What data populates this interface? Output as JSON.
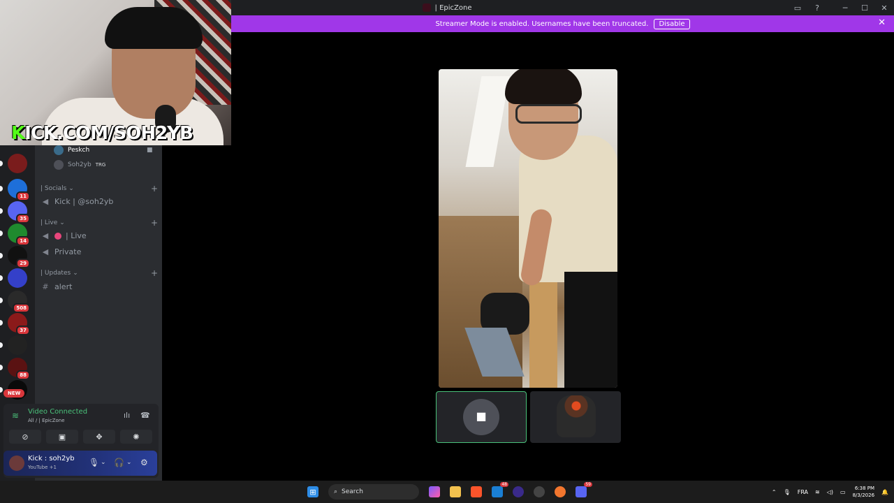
{
  "window": {
    "title": "| EpicZone"
  },
  "banner": {
    "text": "Streamer Mode is enabled. Usernames have been truncated.",
    "button": "Disable"
  },
  "webcam": {
    "overlay_prefix": "K",
    "overlay_text": "ICK.COM/SOH2YB"
  },
  "guilds": [
    {
      "badge": "",
      "color": "#7a1c1c"
    },
    {
      "badge": "11",
      "color": "#1e6fd9"
    },
    {
      "badge": "35",
      "color": "#5865f2"
    },
    {
      "badge": "14",
      "color": "#1f8a2e"
    },
    {
      "badge": "29",
      "color": "#111111"
    },
    {
      "badge": "",
      "color": "#3440c9"
    },
    {
      "badge": "508",
      "color": "#2a2a2a"
    },
    {
      "badge": "37",
      "color": "#8b1a1a"
    },
    {
      "badge": "",
      "color": "#222222"
    },
    {
      "badge": "88",
      "color": "#5a1212"
    },
    {
      "badge": "",
      "color": "#0a0a0a"
    }
  ],
  "new_badge": "NEW",
  "voice_users": [
    {
      "name": "Peskch",
      "tag": ""
    },
    {
      "name": "Soh2yb",
      "tag": "TRG"
    }
  ],
  "categories": [
    {
      "label": "| Socials",
      "channels": [
        {
          "icon": "speaker",
          "name": "Kick | @soh2yb"
        }
      ]
    },
    {
      "label": "| Live",
      "channels": [
        {
          "icon": "speaker",
          "name": "| Live"
        },
        {
          "icon": "speaker",
          "name": "Private"
        }
      ]
    },
    {
      "label": "| Updates",
      "channels": [
        {
          "icon": "hash",
          "name": "alert"
        }
      ]
    }
  ],
  "voice_panel": {
    "status": "Video Connected",
    "location": "All /  | EpicZone"
  },
  "user": {
    "name": "Kick : soh2yb",
    "activity": "YouTube +1"
  },
  "taskbar": {
    "search_placeholder": "Search",
    "language": "FRA",
    "time": "6:38 PM",
    "date": "8/3/2026",
    "badge_edge": "48",
    "badge_discord": "59"
  },
  "colors": {
    "accent": "#a037e8",
    "connected": "#4ac27a",
    "kick_green": "#53fc18"
  }
}
